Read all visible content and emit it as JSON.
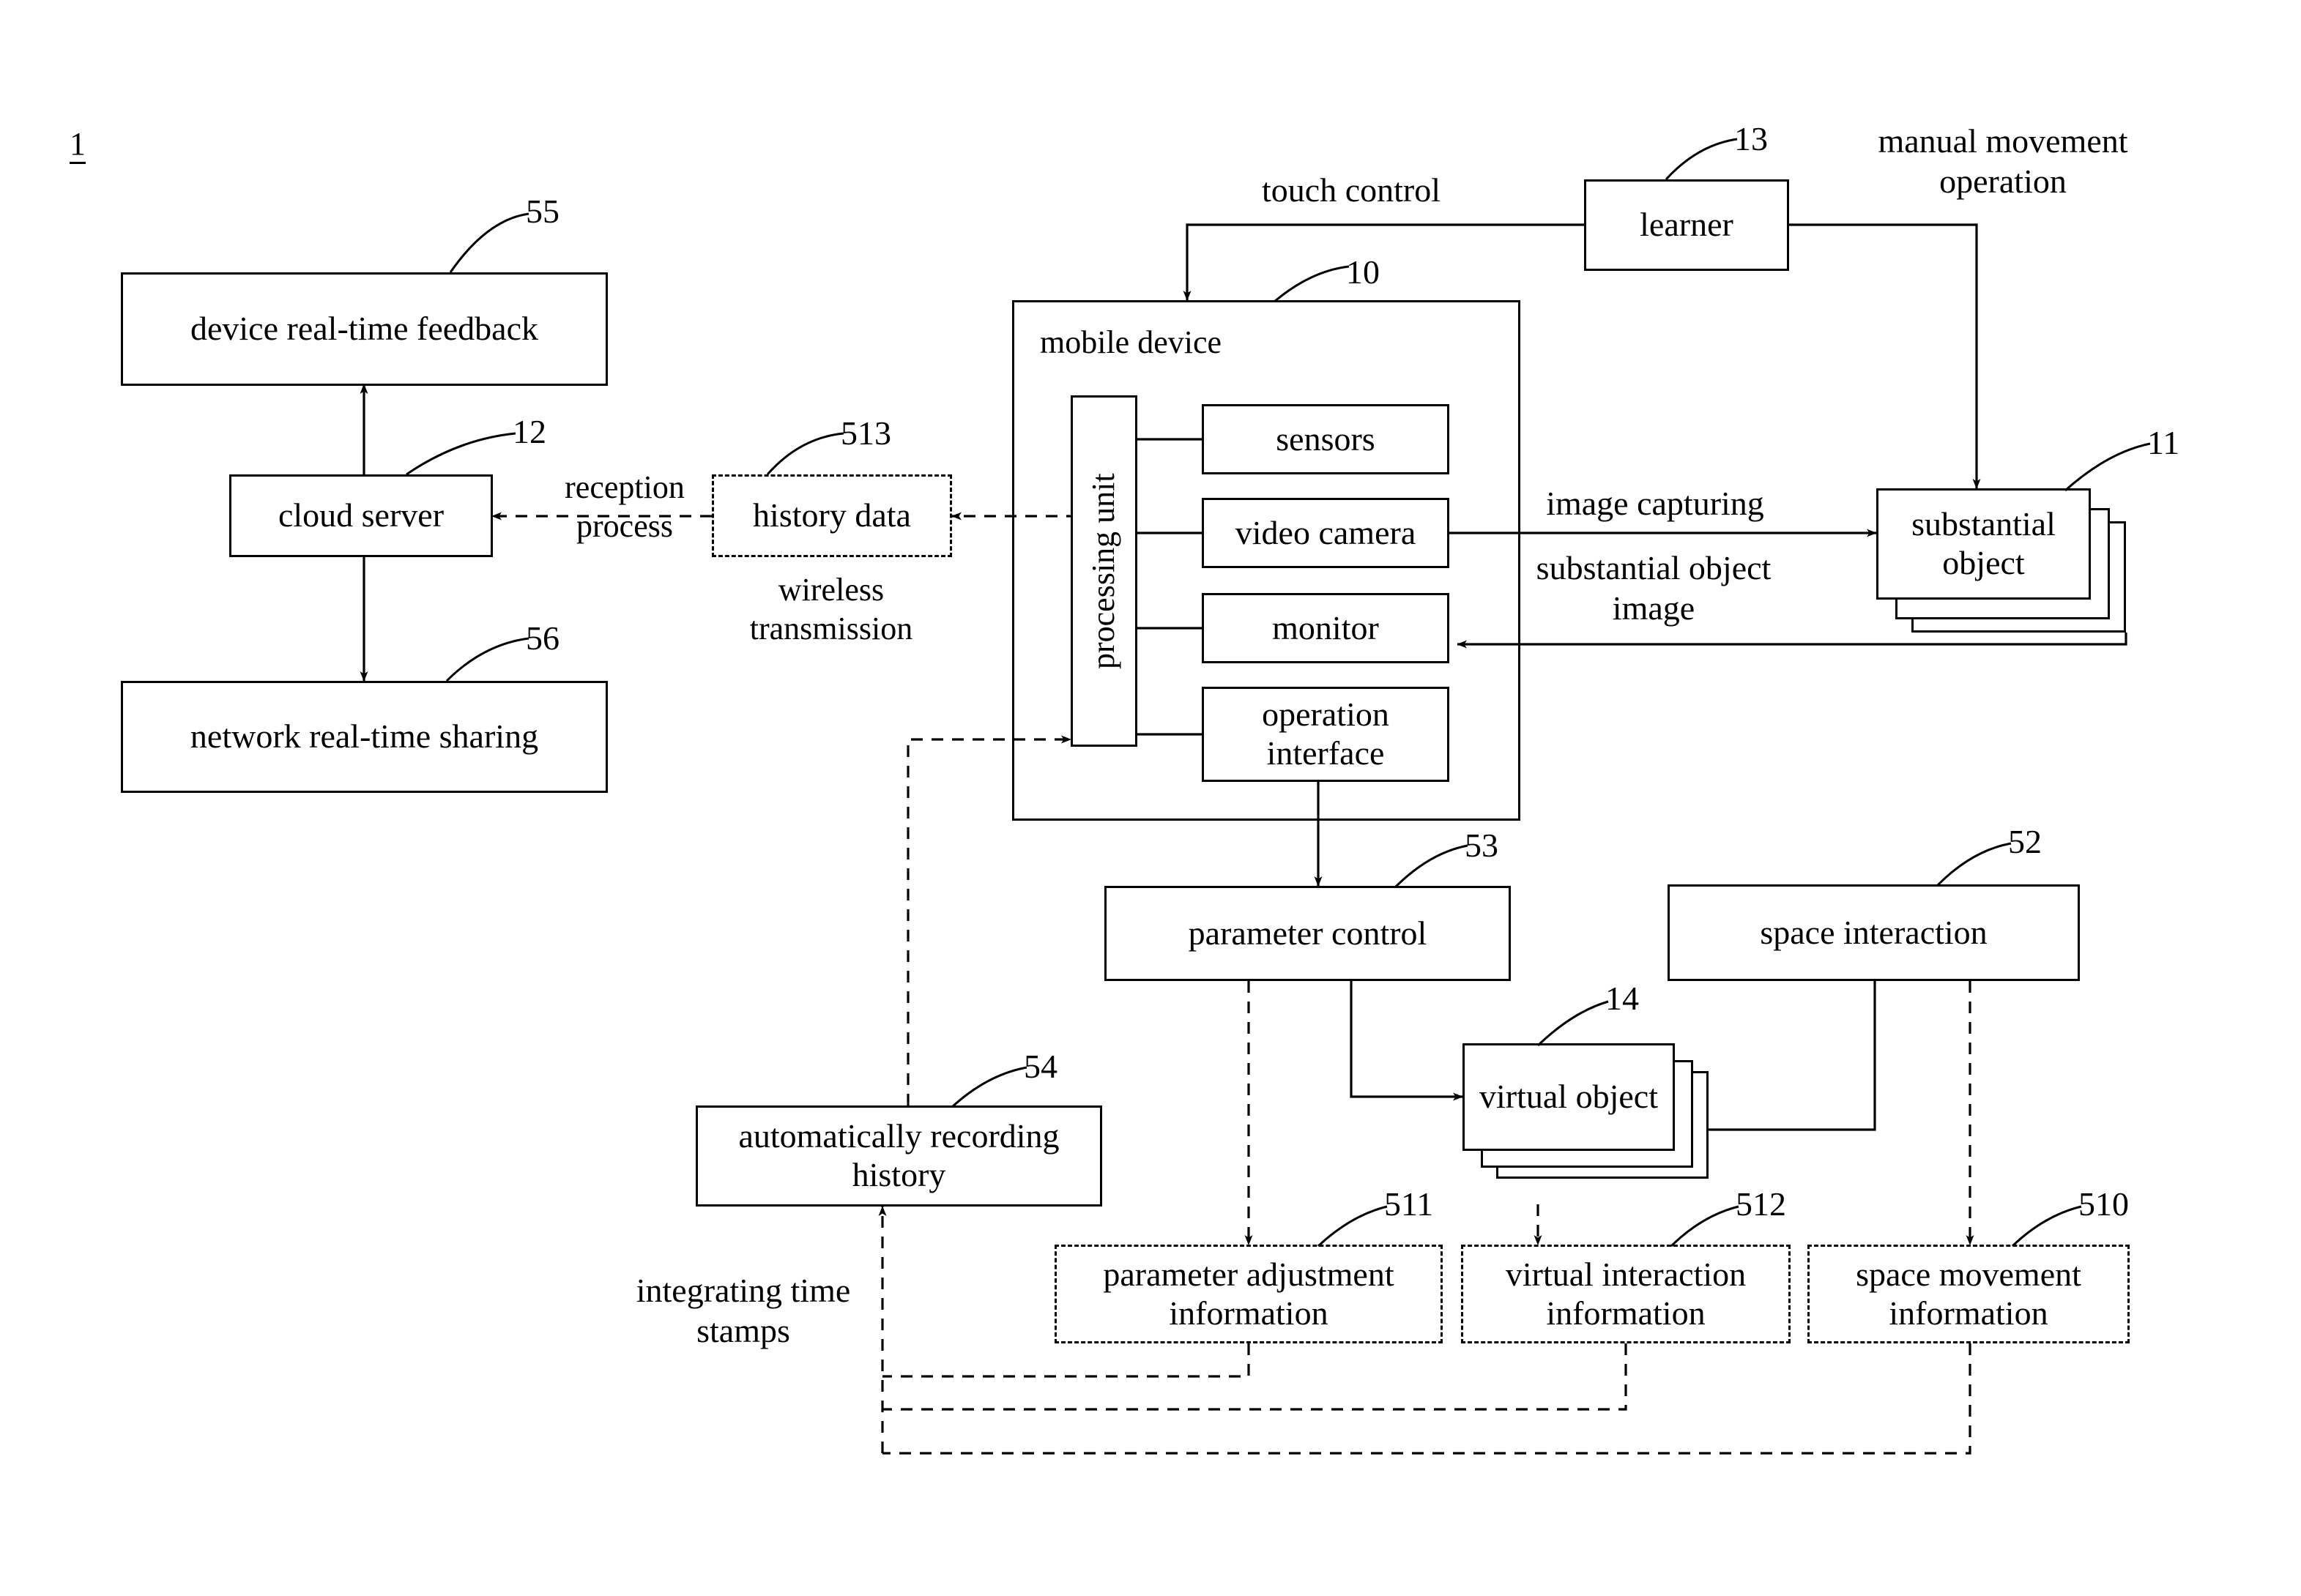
{
  "figure": {
    "id": "1",
    "type": "patent-block-diagram"
  },
  "blocks": {
    "device_feedback": {
      "label": "device real-time feedback",
      "ref": "55"
    },
    "cloud_server": {
      "label": "cloud server",
      "ref": "12"
    },
    "network_sharing": {
      "label": "network real-time sharing",
      "ref": "56"
    },
    "history_data": {
      "label": "history data",
      "ref": "513"
    },
    "mobile_device": {
      "label": "mobile device",
      "ref": "10"
    },
    "processing_unit": {
      "label": "processing unit"
    },
    "sensors": {
      "label": "sensors"
    },
    "video_camera": {
      "label": "video camera"
    },
    "monitor": {
      "label": "monitor"
    },
    "operation_interface": {
      "label": "operation interface"
    },
    "learner": {
      "label": "learner",
      "ref": "13"
    },
    "substantial_object": {
      "label": "substantial object",
      "ref": "11"
    },
    "parameter_control": {
      "label": "parameter control",
      "ref": "53"
    },
    "space_interaction": {
      "label": "space interaction",
      "ref": "52"
    },
    "virtual_object": {
      "label": "virtual object",
      "ref": "14"
    },
    "auto_recording": {
      "label": "automatically recording history",
      "ref": "54"
    },
    "parameter_adjustment_information": {
      "label": "parameter adjustment information",
      "ref": "511"
    },
    "virtual_interaction_information": {
      "label": "virtual interaction information",
      "ref": "512"
    },
    "space_movement_information": {
      "label": "space movement information",
      "ref": "510"
    }
  },
  "edge_labels": {
    "touch_control": "touch control",
    "manual_movement_operation": "manual movement\noperation",
    "reception_process": "reception\nprocess",
    "wireless_transmission": "wireless\ntransmission",
    "image_capturing": "image capturing",
    "substantial_object_image": "substantial object\nimage",
    "integrating_time_stamps": "integrating time\nstamps"
  },
  "style": {
    "ink": "#000000",
    "paper": "#ffffff"
  }
}
